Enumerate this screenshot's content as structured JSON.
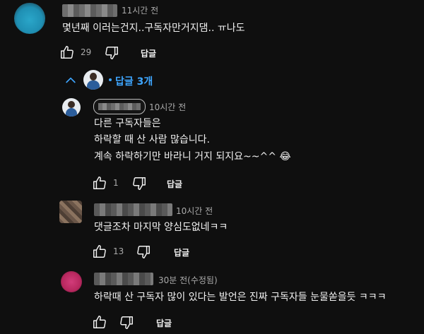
{
  "comments": [
    {
      "time": "11시간 전",
      "text": "몇년째 이러는건지..구독자만거지댐.. ㅠ나도",
      "likes": "29",
      "reply_label": "답글"
    }
  ],
  "replies_toggle": {
    "label": "답글 3개"
  },
  "replies": [
    {
      "time": "10시간 전",
      "lines": [
        "다른 구독자들은",
        "하락할 때 산 사람 많습니다.",
        "계속 하락하기만 바라니 거지 되지요~~^^ 😂"
      ],
      "likes": "1",
      "reply_label": "답글"
    },
    {
      "time": "10시간 전",
      "lines": [
        "댓글조차 마지막 양심도없네ㅋㅋ"
      ],
      "likes": "13",
      "reply_label": "답글"
    },
    {
      "time": "30분 전(수정됨)",
      "lines": [
        "하락때 산 구독자 많이 있다는 발언은 진짜 구독자들 눈물쏟을듯 ㅋㅋㅋ"
      ],
      "likes": "",
      "reply_label": "답글"
    }
  ],
  "colors": {
    "background": "#0f0f0f",
    "link_blue": "#3ea6ff",
    "avatar_main": "#2aa6c9",
    "avatar_pink": "#c0306d"
  },
  "icons": [
    "thumbs-up-icon",
    "thumbs-down-icon",
    "chevron-up-icon"
  ]
}
